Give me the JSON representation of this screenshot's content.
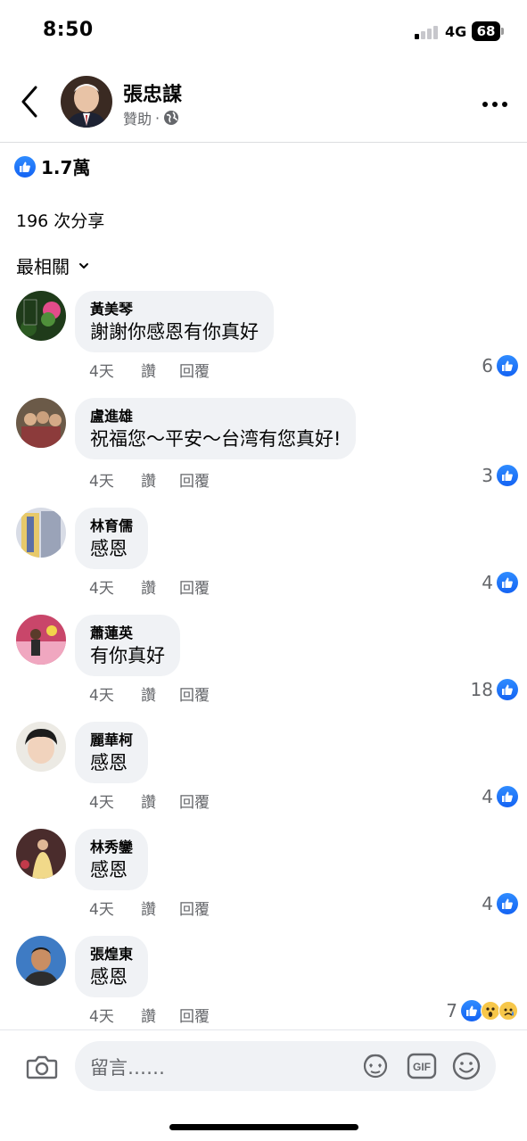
{
  "status_bar": {
    "time": "8:50",
    "network": "4G",
    "battery": "68"
  },
  "header": {
    "page_name": "張忠謀",
    "sponsored_label": "贊助",
    "separator": "·"
  },
  "summary": {
    "likes": "1.7萬",
    "shares": "196 次分享",
    "sort_label": "最相關"
  },
  "comments": [
    {
      "author": "黃美琴",
      "text": "謝謝你感恩有你真好",
      "time": "4天",
      "like_label": "讚",
      "reply_label": "回覆",
      "reaction_count": "6"
    },
    {
      "author": "盧進雄",
      "text": "祝福您～平安～台湾有您真好!",
      "time": "4天",
      "like_label": "讚",
      "reply_label": "回覆",
      "reaction_count": "3"
    },
    {
      "author": "林育儒",
      "text": "感恩",
      "time": "4天",
      "like_label": "讚",
      "reply_label": "回覆",
      "reaction_count": "4"
    },
    {
      "author": "蕭蓮英",
      "text": "有你真好",
      "time": "4天",
      "like_label": "讚",
      "reply_label": "回覆",
      "reaction_count": "18"
    },
    {
      "author": "麗華柯",
      "text": "感恩",
      "time": "4天",
      "like_label": "讚",
      "reply_label": "回覆",
      "reaction_count": "4"
    },
    {
      "author": "林秀鑾",
      "text": "感恩",
      "time": "4天",
      "like_label": "讚",
      "reply_label": "回覆",
      "reaction_count": "4"
    },
    {
      "author": "張煌東",
      "text": "感恩",
      "time": "4天",
      "like_label": "讚",
      "reply_label": "回覆",
      "reaction_count": "7",
      "reaction_types": [
        "like-icon",
        "wow-icon",
        "sad-icon"
      ]
    }
  ],
  "composer": {
    "placeholder": "留言……"
  },
  "icons": {
    "back": "chevron-left-icon",
    "more": "more-horizontal-icon",
    "globe": "globe-icon",
    "like": "like-thumb-icon",
    "camera": "camera-icon",
    "gif": "gif-icon",
    "avatar_sticker": "avatar-sticker-icon",
    "emoji": "emoji-icon"
  },
  "colors": {
    "accent": "#1877f2",
    "bubble": "#f0f2f5",
    "secondary_text": "#65676b"
  }
}
